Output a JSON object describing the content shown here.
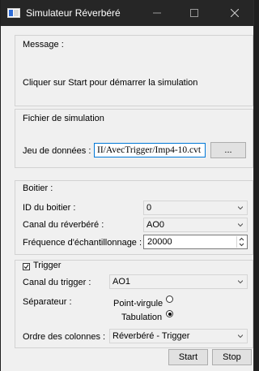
{
  "window": {
    "title": "Simulateur Réverbéré"
  },
  "message": {
    "group_title": "Message :",
    "text": "Cliquer sur Start pour démarrer la simulation"
  },
  "fichier": {
    "group_title": "Fichier de simulation",
    "jeu_label": "Jeu de données :",
    "jeu_value": "II/AvecTrigger/Imp4-10.cvt",
    "browse_label": "..."
  },
  "boitier": {
    "group_title": "Boitier :",
    "id_label": "ID du boitier :",
    "id_value": "0",
    "canal_label": "Canal du réverbéré :",
    "canal_value": "AO0",
    "freq_label": "Fréquence d'échantillonnage :",
    "freq_value": "20000"
  },
  "trigger": {
    "group_title": "Trigger",
    "checked": true,
    "canal_label": "Canal du trigger :",
    "canal_value": "AO1",
    "sep_label": "Séparateur :",
    "sep_options": [
      "Point-virgule",
      "Tabulation"
    ],
    "sep_selected": "Tabulation",
    "ordre_label": "Ordre des colonnes :",
    "ordre_value": "Réverbéré - Trigger"
  },
  "actions": {
    "start_label": "Start",
    "stop_label": "Stop"
  }
}
